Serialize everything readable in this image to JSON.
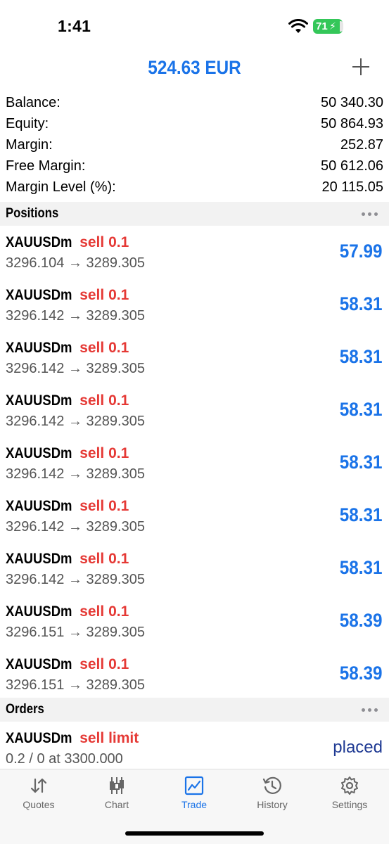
{
  "status_bar": {
    "time": "1:41",
    "battery_level": "71"
  },
  "header": {
    "title": "524.63 EUR"
  },
  "summary": [
    {
      "label": "Balance:",
      "value": "50 340.30"
    },
    {
      "label": "Equity:",
      "value": "50 864.93"
    },
    {
      "label": "Margin:",
      "value": "252.87"
    },
    {
      "label": "Free Margin:",
      "value": "50 612.06"
    },
    {
      "label": "Margin Level (%):",
      "value": "20 115.05"
    }
  ],
  "positions": {
    "title": "Positions",
    "items": [
      {
        "symbol": "XAUUSDm",
        "side": "sell 0.1",
        "prices": "3296.104 → 3289.305",
        "profit": "57.99"
      },
      {
        "symbol": "XAUUSDm",
        "side": "sell 0.1",
        "prices": "3296.142 → 3289.305",
        "profit": "58.31"
      },
      {
        "symbol": "XAUUSDm",
        "side": "sell 0.1",
        "prices": "3296.142 → 3289.305",
        "profit": "58.31"
      },
      {
        "symbol": "XAUUSDm",
        "side": "sell 0.1",
        "prices": "3296.142 → 3289.305",
        "profit": "58.31"
      },
      {
        "symbol": "XAUUSDm",
        "side": "sell 0.1",
        "prices": "3296.142 → 3289.305",
        "profit": "58.31"
      },
      {
        "symbol": "XAUUSDm",
        "side": "sell 0.1",
        "prices": "3296.142 → 3289.305",
        "profit": "58.31"
      },
      {
        "symbol": "XAUUSDm",
        "side": "sell 0.1",
        "prices": "3296.142 → 3289.305",
        "profit": "58.31"
      },
      {
        "symbol": "XAUUSDm",
        "side": "sell 0.1",
        "prices": "3296.151 → 3289.305",
        "profit": "58.39"
      },
      {
        "symbol": "XAUUSDm",
        "side": "sell 0.1",
        "prices": "3296.151 → 3289.305",
        "profit": "58.39"
      }
    ]
  },
  "orders": {
    "title": "Orders",
    "items": [
      {
        "symbol": "XAUUSDm",
        "side": "sell limit",
        "details": "0.2 / 0 at 3300.000",
        "state": "placed"
      }
    ]
  },
  "tabs": [
    {
      "label": "Quotes",
      "icon": "quotes-arrows-icon"
    },
    {
      "label": "Chart",
      "icon": "candlestick-chart-icon"
    },
    {
      "label": "Trade",
      "icon": "trade-line-chart-icon",
      "active": true
    },
    {
      "label": "History",
      "icon": "history-clock-icon"
    },
    {
      "label": "Settings",
      "icon": "gear-icon"
    }
  ],
  "colors": {
    "accent": "#1a73e8",
    "sell": "#e53935",
    "order_state": "#1f3a93",
    "battery": "#34c759"
  }
}
